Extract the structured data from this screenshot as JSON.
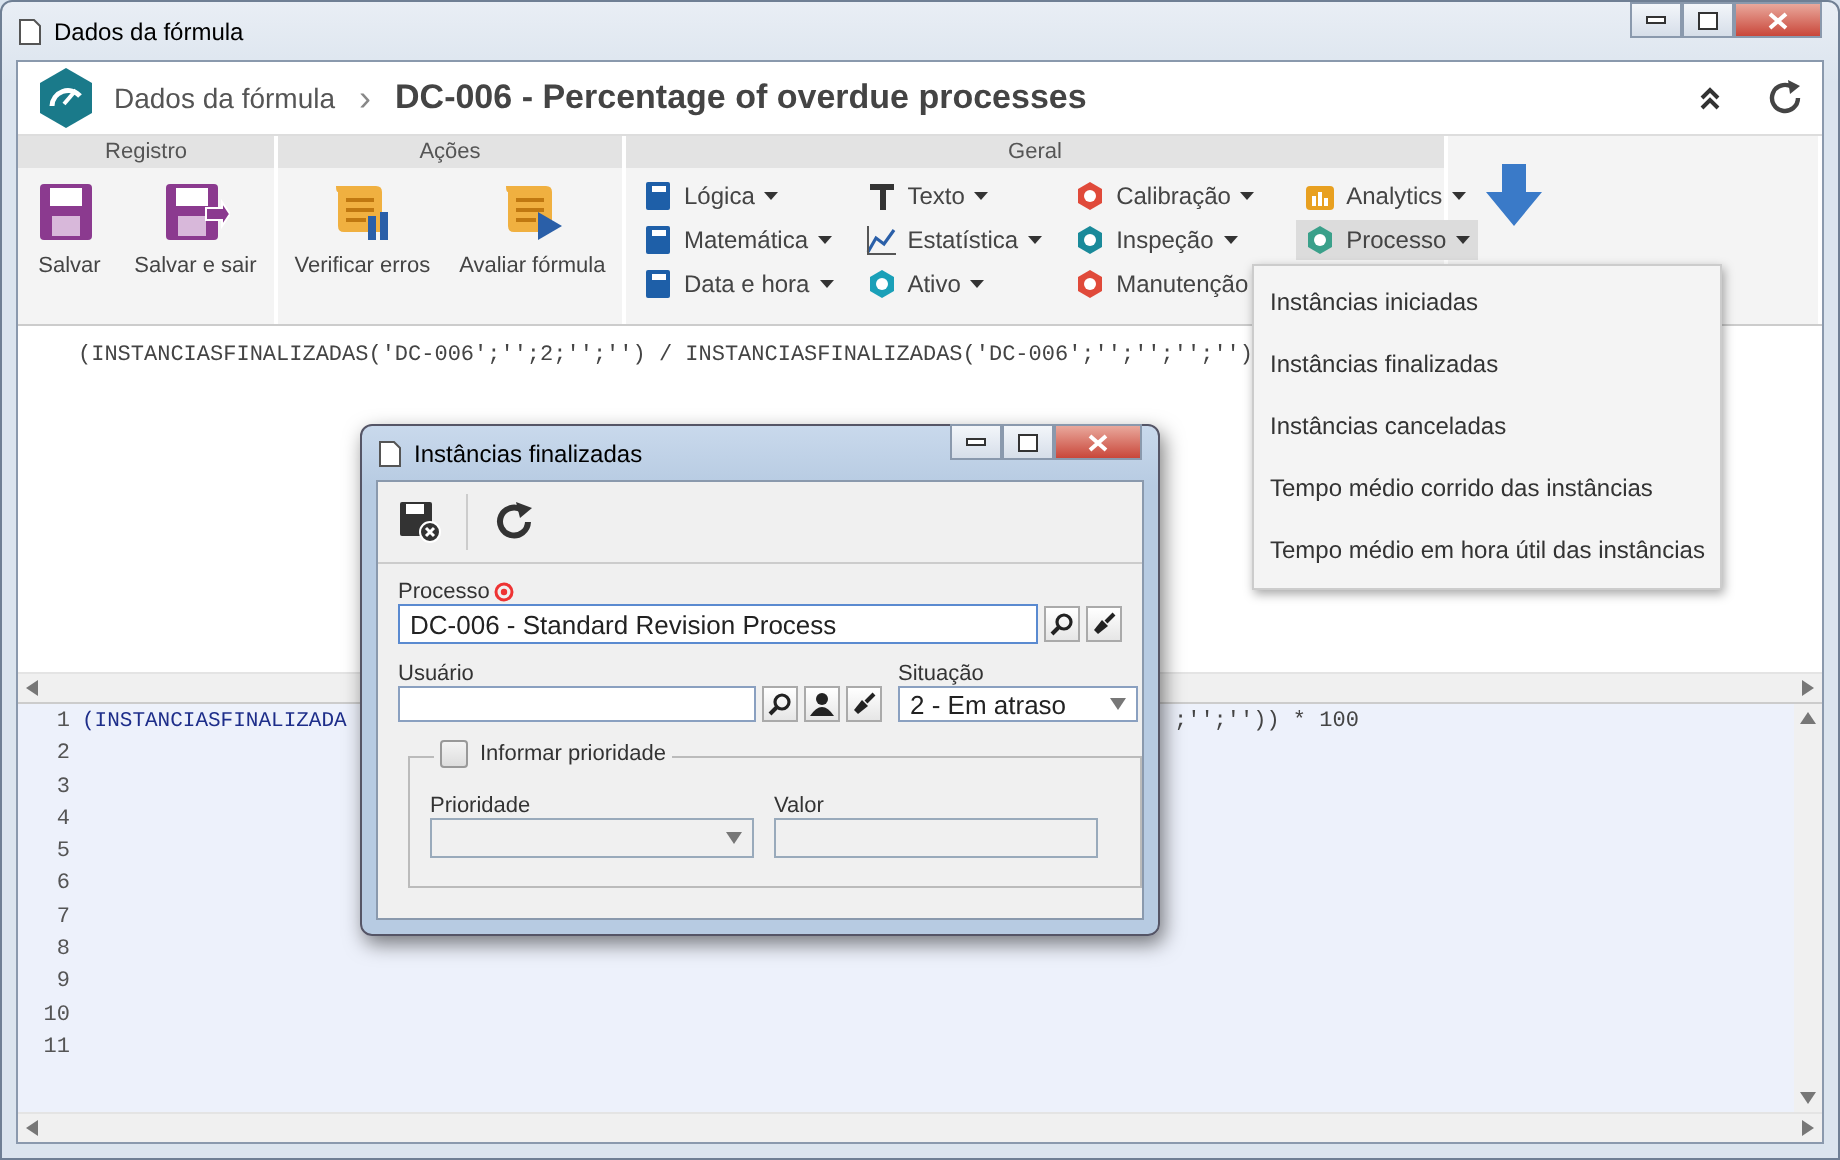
{
  "window": {
    "title": "Dados da fórmula"
  },
  "header": {
    "breadcrumb": "Dados da fórmula",
    "separator": "›",
    "title": "DC-006 - Percentage of overdue processes"
  },
  "ribbon": {
    "groups": [
      {
        "title": "Registro",
        "kind": "large",
        "buttons": [
          {
            "label": "Salvar"
          },
          {
            "label": "Salvar e sair"
          }
        ]
      },
      {
        "title": "Ações",
        "kind": "large",
        "buttons": [
          {
            "label": "Verificar erros"
          },
          {
            "label": "Avaliar fórmula"
          }
        ]
      },
      {
        "title": "Geral",
        "kind": "menus",
        "columns": [
          [
            {
              "label": "Lógica",
              "expanded": false
            },
            {
              "label": "Matemática",
              "expanded": false
            },
            {
              "label": "Data e hora",
              "expanded": false
            }
          ],
          [
            {
              "label": "Texto",
              "expanded": false
            },
            {
              "label": "Estatística",
              "expanded": false
            },
            {
              "label": "Ativo",
              "expanded": false
            }
          ],
          [
            {
              "label": "Calibração",
              "expanded": false
            },
            {
              "label": "Inspeção",
              "expanded": false
            },
            {
              "label": "Manutenção",
              "expanded": false
            }
          ],
          [
            {
              "label": "Analytics",
              "expanded": false
            },
            {
              "label": "Processo",
              "expanded": true
            }
          ]
        ]
      }
    ]
  },
  "menu": {
    "items": [
      "Instâncias iniciadas",
      "Instâncias finalizadas",
      "Instâncias canceladas",
      "Tempo médio corrido das instâncias",
      "Tempo médio em hora útil das instâncias"
    ]
  },
  "editor_top": {
    "line": "(INSTANCIASFINALIZADAS('DC-006';'';2;'';'') / INSTANCIASFINALIZADAS('DC-006';'';'';'';'')"
  },
  "editor_bottom": {
    "lines": [
      {
        "number": "1",
        "start": "(INSTANCIASFINALIZADA",
        "end": ";'';'')) * 100"
      },
      {
        "number": "2"
      },
      {
        "number": "3"
      },
      {
        "number": "4"
      },
      {
        "number": "5"
      },
      {
        "number": "6"
      },
      {
        "number": "7"
      },
      {
        "number": "8"
      },
      {
        "number": "9"
      },
      {
        "number": "10"
      },
      {
        "number": "11"
      }
    ]
  },
  "dialog": {
    "title": "Instâncias finalizadas",
    "processo": {
      "label": "Processo",
      "value": "DC-006 - Standard Revision Process",
      "required": true
    },
    "usuario": {
      "label": "Usuário"
    },
    "situacao": {
      "label": "Situação",
      "value": "2 - Em atraso"
    },
    "prioridade_group": {
      "label": "Informar prioridade",
      "checked": false
    },
    "prioridade": {
      "label": "Prioridade"
    },
    "valor": {
      "label": "Valor"
    }
  }
}
